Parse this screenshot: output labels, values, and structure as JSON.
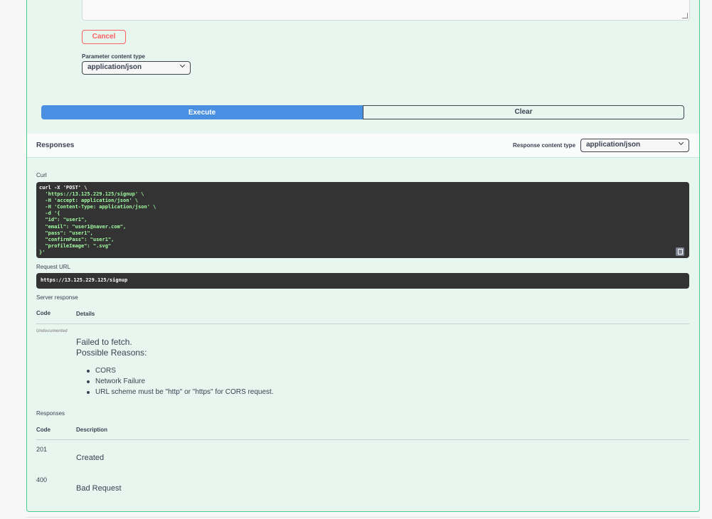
{
  "form": {
    "cancel_label": "Cancel",
    "param_content_type_label": "Parameter content type",
    "param_content_type_value": "application/json",
    "execute_label": "Execute",
    "clear_label": "Clear"
  },
  "responses_section": {
    "title": "Responses",
    "content_type_label": "Response content type",
    "content_type_value": "application/json"
  },
  "curl": {
    "label": "Curl",
    "lines": [
      "curl -X 'POST' \\",
      "  'https://13.125.229.125/signup' \\",
      "  -H 'accept: application/json' \\",
      "  -H 'Content-Type: application/json' \\",
      "  -d '{",
      "  \"id\": \"user1\",",
      "  \"email\": \"user1@naver.com\",",
      "  \"pass\": \"user1\",",
      "  \"confirmPass\": \"user1\",",
      "  \"profileImage\": \".svg\"",
      "}'"
    ]
  },
  "request_url": {
    "label": "Request URL",
    "value": "https://13.125.229.125/signup"
  },
  "server_response": {
    "label": "Server response",
    "code_header": "Code",
    "details_header": "Details",
    "code": "Undocumented",
    "error_title": "Failed to fetch.",
    "error_subtitle": "Possible Reasons:",
    "reasons": [
      "CORS",
      "Network Failure",
      "URL scheme must be \"http\" or \"https\" for CORS request."
    ]
  },
  "documented_responses": {
    "label": "Responses",
    "code_header": "Code",
    "description_header": "Description",
    "rows": [
      {
        "code": "201",
        "description": "Created"
      },
      {
        "code": "400",
        "description": "Bad Request"
      }
    ]
  },
  "colors": {
    "post_border": "#49cc90",
    "post_bg": "#e8f6f0",
    "execute_bg": "#4990e2",
    "cancel_red": "#ff6060",
    "code_bg": "#333333",
    "curl_string": "#a2fca2"
  },
  "icons": {
    "copy": "copy-to-clipboard-icon",
    "resize": "resize-grip-icon",
    "chevron": "chevron-down-icon"
  }
}
